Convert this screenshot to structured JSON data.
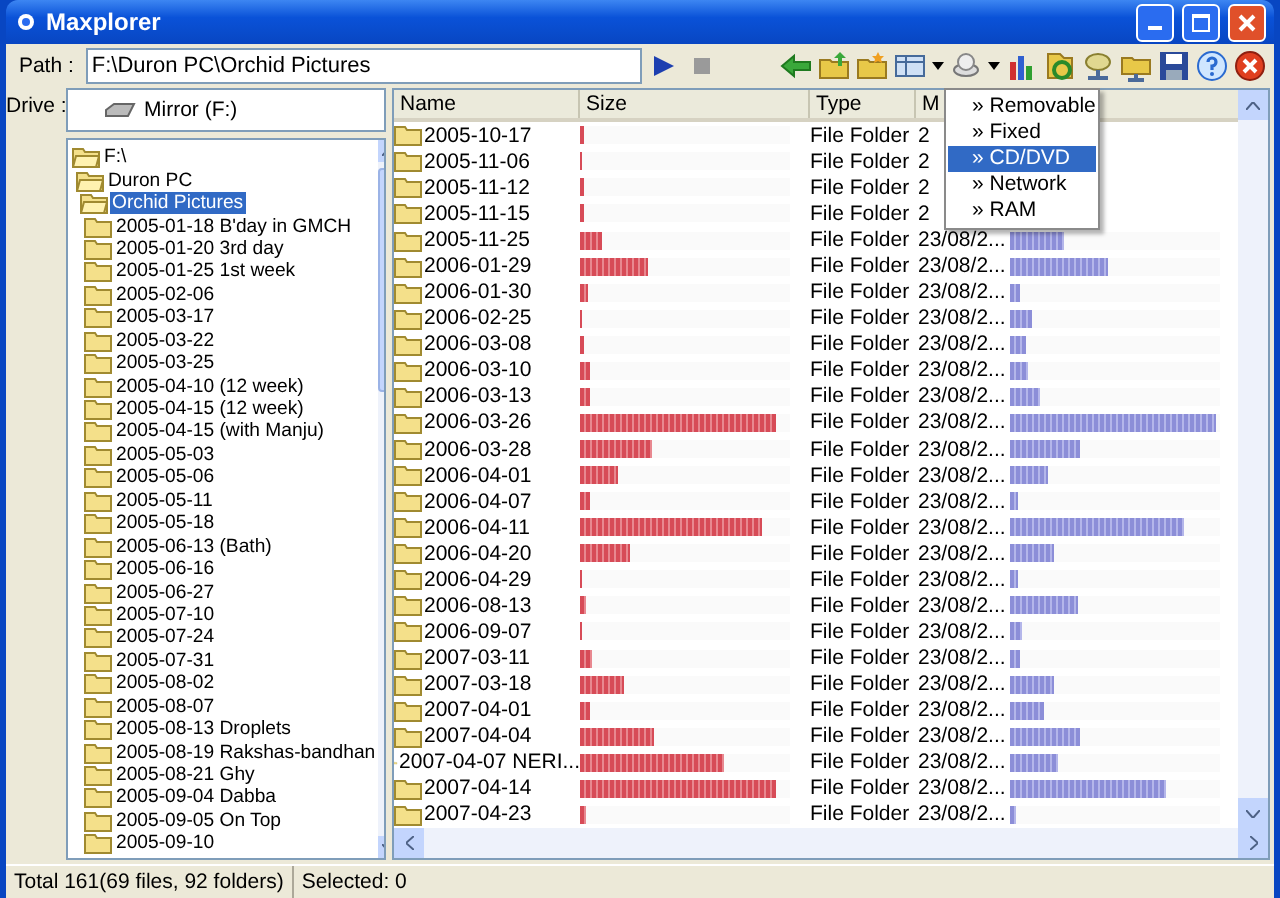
{
  "window": {
    "title": "Maxplorer"
  },
  "path": {
    "label": "Path :",
    "value": "F:\\Duron PC\\Orchid Pictures"
  },
  "drive": {
    "label": "Drive :",
    "value": "Mirror (F:)"
  },
  "tree": [
    {
      "label": "F:\\",
      "selected": false,
      "expanded": true,
      "children": [
        {
          "label": "Duron PC",
          "selected": false,
          "expanded": true,
          "children": [
            {
              "label": "Orchid Pictures",
              "selected": true,
              "expanded": true,
              "children": [
                {
                  "label": "2005-01-18 B'day in GMCH",
                  "selected": false
                },
                {
                  "label": "2005-01-20 3rd day",
                  "selected": false
                },
                {
                  "label": "2005-01-25 1st week",
                  "selected": false
                },
                {
                  "label": "2005-02-06",
                  "selected": false
                },
                {
                  "label": "2005-03-17",
                  "selected": false
                },
                {
                  "label": "2005-03-22",
                  "selected": false
                },
                {
                  "label": "2005-03-25",
                  "selected": false
                },
                {
                  "label": "2005-04-10 (12 week)",
                  "selected": false
                },
                {
                  "label": "2005-04-15  (12 week)",
                  "selected": false
                },
                {
                  "label": "2005-04-15  (with Manju)",
                  "selected": false
                },
                {
                  "label": "2005-05-03",
                  "selected": false
                },
                {
                  "label": "2005-05-06",
                  "selected": false
                },
                {
                  "label": "2005-05-11",
                  "selected": false
                },
                {
                  "label": "2005-05-18",
                  "selected": false
                },
                {
                  "label": "2005-06-13 (Bath)",
                  "selected": false
                },
                {
                  "label": "2005-06-16",
                  "selected": false
                },
                {
                  "label": "2005-06-27",
                  "selected": false
                },
                {
                  "label": "2005-07-10",
                  "selected": false
                },
                {
                  "label": "2005-07-24",
                  "selected": false
                },
                {
                  "label": "2005-07-31",
                  "selected": false
                },
                {
                  "label": "2005-08-02",
                  "selected": false
                },
                {
                  "label": "2005-08-07",
                  "selected": false
                },
                {
                  "label": "2005-08-13 Droplets",
                  "selected": false
                },
                {
                  "label": "2005-08-19 Rakshas-bandhan",
                  "selected": false
                },
                {
                  "label": "2005-08-21 Ghy",
                  "selected": false
                },
                {
                  "label": "2005-09-04 Dabba",
                  "selected": false
                },
                {
                  "label": "2005-09-05 On Top",
                  "selected": false
                },
                {
                  "label": "2005-09-10",
                  "selected": false
                }
              ]
            }
          ]
        }
      ]
    }
  ],
  "list": {
    "columns": [
      "Name",
      "Size",
      "Type",
      "M"
    ],
    "rows": [
      {
        "name": "2005-10-17",
        "size": {
          "level": 0.02
        },
        "type": "File Folder",
        "modified": "2"
      },
      {
        "name": "2005-11-06",
        "size": {
          "level": 0.01
        },
        "type": "File Folder",
        "modified": "2"
      },
      {
        "name": "2005-11-12",
        "size": {
          "level": 0.02
        },
        "type": "File Folder",
        "modified": "2"
      },
      {
        "name": "2005-11-15",
        "size": {
          "level": 0.02
        },
        "type": "File Folder",
        "modified": "2"
      },
      {
        "name": "2005-11-25",
        "size": {
          "level": 0.1
        },
        "type": "File Folder",
        "modified": "23/08/2...",
        "usage": {
          "level": 0.26
        }
      },
      {
        "name": "2006-01-29",
        "size": {
          "level": 0.32
        },
        "type": "File Folder",
        "modified": "23/08/2...",
        "usage": {
          "level": 0.47
        }
      },
      {
        "name": "2006-01-30",
        "size": {
          "level": 0.04
        },
        "type": "File Folder",
        "modified": "23/08/2...",
        "usage": {
          "level": 0.05
        }
      },
      {
        "name": "2006-02-25",
        "size": {
          "level": 0.01
        },
        "type": "File Folder",
        "modified": "23/08/2...",
        "usage": {
          "level": 0.1
        }
      },
      {
        "name": "2006-03-08",
        "size": {
          "level": 0.02
        },
        "type": "File Folder",
        "modified": "23/08/2...",
        "usage": {
          "level": 0.08
        }
      },
      {
        "name": "2006-03-10",
        "size": {
          "level": 0.05
        },
        "type": "File Folder",
        "modified": "23/08/2...",
        "usage": {
          "level": 0.09
        }
      },
      {
        "name": "2006-03-13",
        "size": {
          "level": 0.05
        },
        "type": "File Folder",
        "modified": "23/08/2...",
        "usage": {
          "level": 0.14
        }
      },
      {
        "name": "2006-03-26",
        "size": {
          "level": 0.93
        },
        "type": "File Folder",
        "modified": "23/08/2...",
        "usage": {
          "level": 0.98
        }
      },
      {
        "name": "2006-03-28",
        "size": {
          "level": 0.34
        },
        "type": "File Folder",
        "modified": "23/08/2...",
        "usage": {
          "level": 0.33
        }
      },
      {
        "name": "2006-04-01",
        "size": {
          "level": 0.18
        },
        "type": "File Folder",
        "modified": "23/08/2...",
        "usage": {
          "level": 0.18
        }
      },
      {
        "name": "2006-04-07",
        "size": {
          "level": 0.05
        },
        "type": "File Folder",
        "modified": "23/08/2...",
        "usage": {
          "level": 0.04
        }
      },
      {
        "name": "2006-04-11",
        "size": {
          "level": 0.87
        },
        "type": "File Folder",
        "modified": "23/08/2...",
        "usage": {
          "level": 0.83
        }
      },
      {
        "name": "2006-04-20",
        "size": {
          "level": 0.24
        },
        "type": "File Folder",
        "modified": "23/08/2...",
        "usage": {
          "level": 0.21
        }
      },
      {
        "name": "2006-04-29",
        "size": {
          "level": 0.01
        },
        "type": "File Folder",
        "modified": "23/08/2...",
        "usage": {
          "level": 0.04
        }
      },
      {
        "name": "2006-08-13",
        "size": {
          "level": 0.03
        },
        "type": "File Folder",
        "modified": "23/08/2...",
        "usage": {
          "level": 0.32
        }
      },
      {
        "name": "2006-09-07",
        "size": {
          "level": 0.01
        },
        "type": "File Folder",
        "modified": "23/08/2...",
        "usage": {
          "level": 0.06
        }
      },
      {
        "name": "2007-03-11",
        "size": {
          "level": 0.06
        },
        "type": "File Folder",
        "modified": "23/08/2...",
        "usage": {
          "level": 0.05
        }
      },
      {
        "name": "2007-03-18",
        "size": {
          "level": 0.21
        },
        "type": "File Folder",
        "modified": "23/08/2...",
        "usage": {
          "level": 0.21
        }
      },
      {
        "name": "2007-04-01",
        "size": {
          "level": 0.05
        },
        "type": "File Folder",
        "modified": "23/08/2...",
        "usage": {
          "level": 0.16
        }
      },
      {
        "name": "2007-04-04",
        "size": {
          "level": 0.35
        },
        "type": "File Folder",
        "modified": "23/08/2...",
        "usage": {
          "level": 0.33
        }
      },
      {
        "name": "2007-04-07 NERI...",
        "size": {
          "level": 0.69
        },
        "type": "File Folder",
        "modified": "23/08/2...",
        "usage": {
          "level": 0.23
        }
      },
      {
        "name": "2007-04-14",
        "size": {
          "level": 0.93
        },
        "type": "File Folder",
        "modified": "23/08/2...",
        "usage": {
          "level": 0.74
        }
      },
      {
        "name": "2007-04-23",
        "size": {
          "level": 0.03
        },
        "type": "File Folder",
        "modified": "23/08/2...",
        "usage": {
          "level": 0.03
        }
      }
    ]
  },
  "drive_menu": [
    {
      "label": "» Removable",
      "selected": false
    },
    {
      "label": "» Fixed",
      "selected": false
    },
    {
      "label": "» CD/DVD",
      "selected": true
    },
    {
      "label": "» Network",
      "selected": false
    },
    {
      "label": "» RAM",
      "selected": false
    }
  ],
  "status_bar": [
    "Total 161(69 files, 92 folders)",
    "Selected: 0"
  ]
}
